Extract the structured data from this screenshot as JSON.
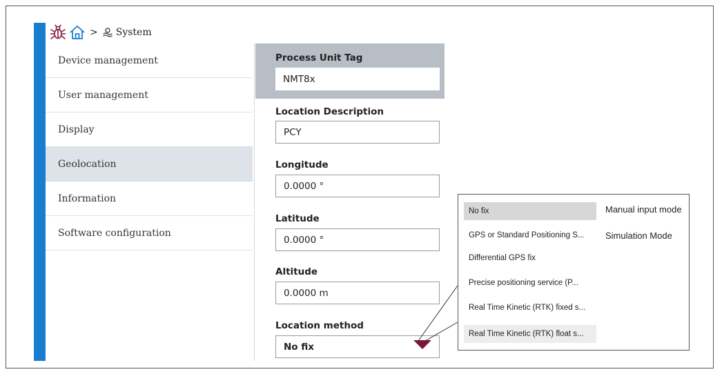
{
  "breadcrumb": {
    "separator": ">",
    "current": "System"
  },
  "sidebar": {
    "items": [
      {
        "label": "Device management"
      },
      {
        "label": "User management"
      },
      {
        "label": "Display"
      },
      {
        "label": "Geolocation",
        "active": true
      },
      {
        "label": "Information"
      },
      {
        "label": "Software configuration"
      }
    ]
  },
  "form": {
    "process_unit_tag": {
      "label": "Process Unit Tag",
      "value": "NMT8x"
    },
    "location_description": {
      "label": "Location Description",
      "value": "PCY"
    },
    "longitude": {
      "label": "Longitude",
      "value": "0.0000 °"
    },
    "latitude": {
      "label": "Latitude",
      "value": "0.0000 °"
    },
    "altitude": {
      "label": "Altitude",
      "value": "0.0000 m"
    },
    "location_method": {
      "label": "Location method",
      "value": "No fix"
    }
  },
  "popup": {
    "options": [
      "No fix",
      "GPS or Standard Positioning S...",
      "Differential GPS fix",
      "Precise positioning service (P...",
      "Real Time Kinetic (RTK) fixed s...",
      "Real Time Kinetic (RTK) float s..."
    ],
    "modes": [
      "Manual input mode",
      "Simulation Mode"
    ]
  },
  "colors": {
    "accent": "#1a7ed0",
    "active_item": "#dde3e9",
    "tag_header": "#b7bec6",
    "dropdown_arrow": "#7a1636",
    "bug_icon": "#8a1c3a",
    "home_icon": "#1a7ed0"
  }
}
